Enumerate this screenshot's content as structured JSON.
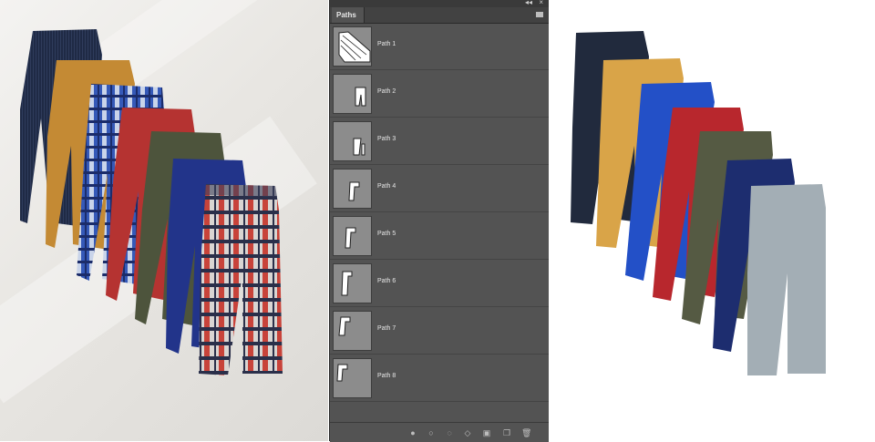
{
  "panel": {
    "tab_label": "Paths",
    "collapse_glyph": "◂◂",
    "close_glyph": "×",
    "paths": [
      {
        "label": "Path 1"
      },
      {
        "label": "Path 2"
      },
      {
        "label": "Path 3"
      },
      {
        "label": "Path 4"
      },
      {
        "label": "Path 5"
      },
      {
        "label": "Path 6"
      },
      {
        "label": "Path 7"
      },
      {
        "label": "Path 8"
      }
    ],
    "bottom_tools": [
      "fill-path-icon",
      "stroke-path-icon",
      "load-as-selection-icon",
      "make-work-path-icon",
      "add-mask-icon",
      "new-path-icon",
      "delete-path-icon"
    ]
  },
  "colors": {
    "panel_bg": "#535353",
    "thumb_bg": "#8c8c8c",
    "pants_navy": "#212a3d",
    "pants_mustard": "#d9a448",
    "pants_royal": "#2350c7",
    "pants_red": "#b8272d",
    "pants_olive": "#555a43",
    "pants_indigo": "#1d2d6f",
    "pants_grey": "#a3aeb5"
  }
}
